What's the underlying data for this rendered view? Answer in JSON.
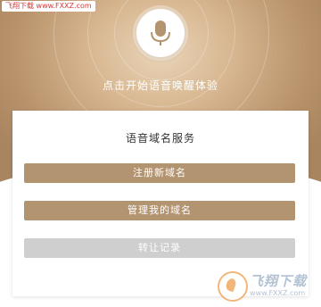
{
  "watermark_top": "飞翔下载 www.FXXZ.com",
  "hero": {
    "hint": "点击开始语音唤醒体验"
  },
  "card": {
    "title": "语音域名服务",
    "buttons": [
      {
        "label": "注册新域名",
        "state": "active"
      },
      {
        "label": "管理我的域名",
        "state": "active"
      },
      {
        "label": "转让记录",
        "state": "disabled"
      }
    ]
  },
  "watermark_bottom": {
    "name": "飞翔下载",
    "url": "www.FXXZ.com"
  },
  "colors": {
    "accent": "#b39471",
    "disabled": "#cfcfcf",
    "hero_light": "#e9d4b8",
    "hero_dark": "#a8845f"
  },
  "icons": {
    "mic": "microphone-icon",
    "logo": "fxxz-logo-icon"
  }
}
